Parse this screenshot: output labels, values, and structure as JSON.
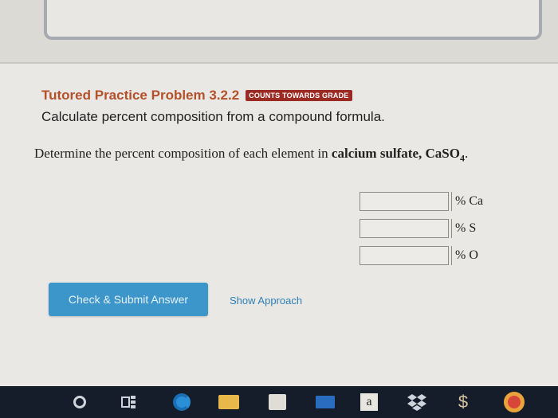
{
  "problem": {
    "title": "Tutored Practice Problem 3.2.2",
    "badge": "COUNTS TOWARDS GRADE",
    "subtitle": "Calculate percent composition from a compound formula."
  },
  "question": {
    "prefix": "Determine the percent composition of each element in ",
    "compound": "calcium sulfate, CaSO",
    "subscript": "4",
    "suffix": "."
  },
  "answers": [
    {
      "value": "",
      "unit": "% Ca"
    },
    {
      "value": "",
      "unit": "% S"
    },
    {
      "value": "",
      "unit": "% O"
    }
  ],
  "actions": {
    "submit_label": "Check & Submit Answer",
    "approach_label": "Show Approach"
  },
  "taskbar": {
    "amazon_letter": "a",
    "dollar_glyph": "$"
  },
  "colors": {
    "title": "#b4502a",
    "badge": "#9b2a23",
    "submit": "#3d96c9",
    "link": "#2f7fb6"
  }
}
